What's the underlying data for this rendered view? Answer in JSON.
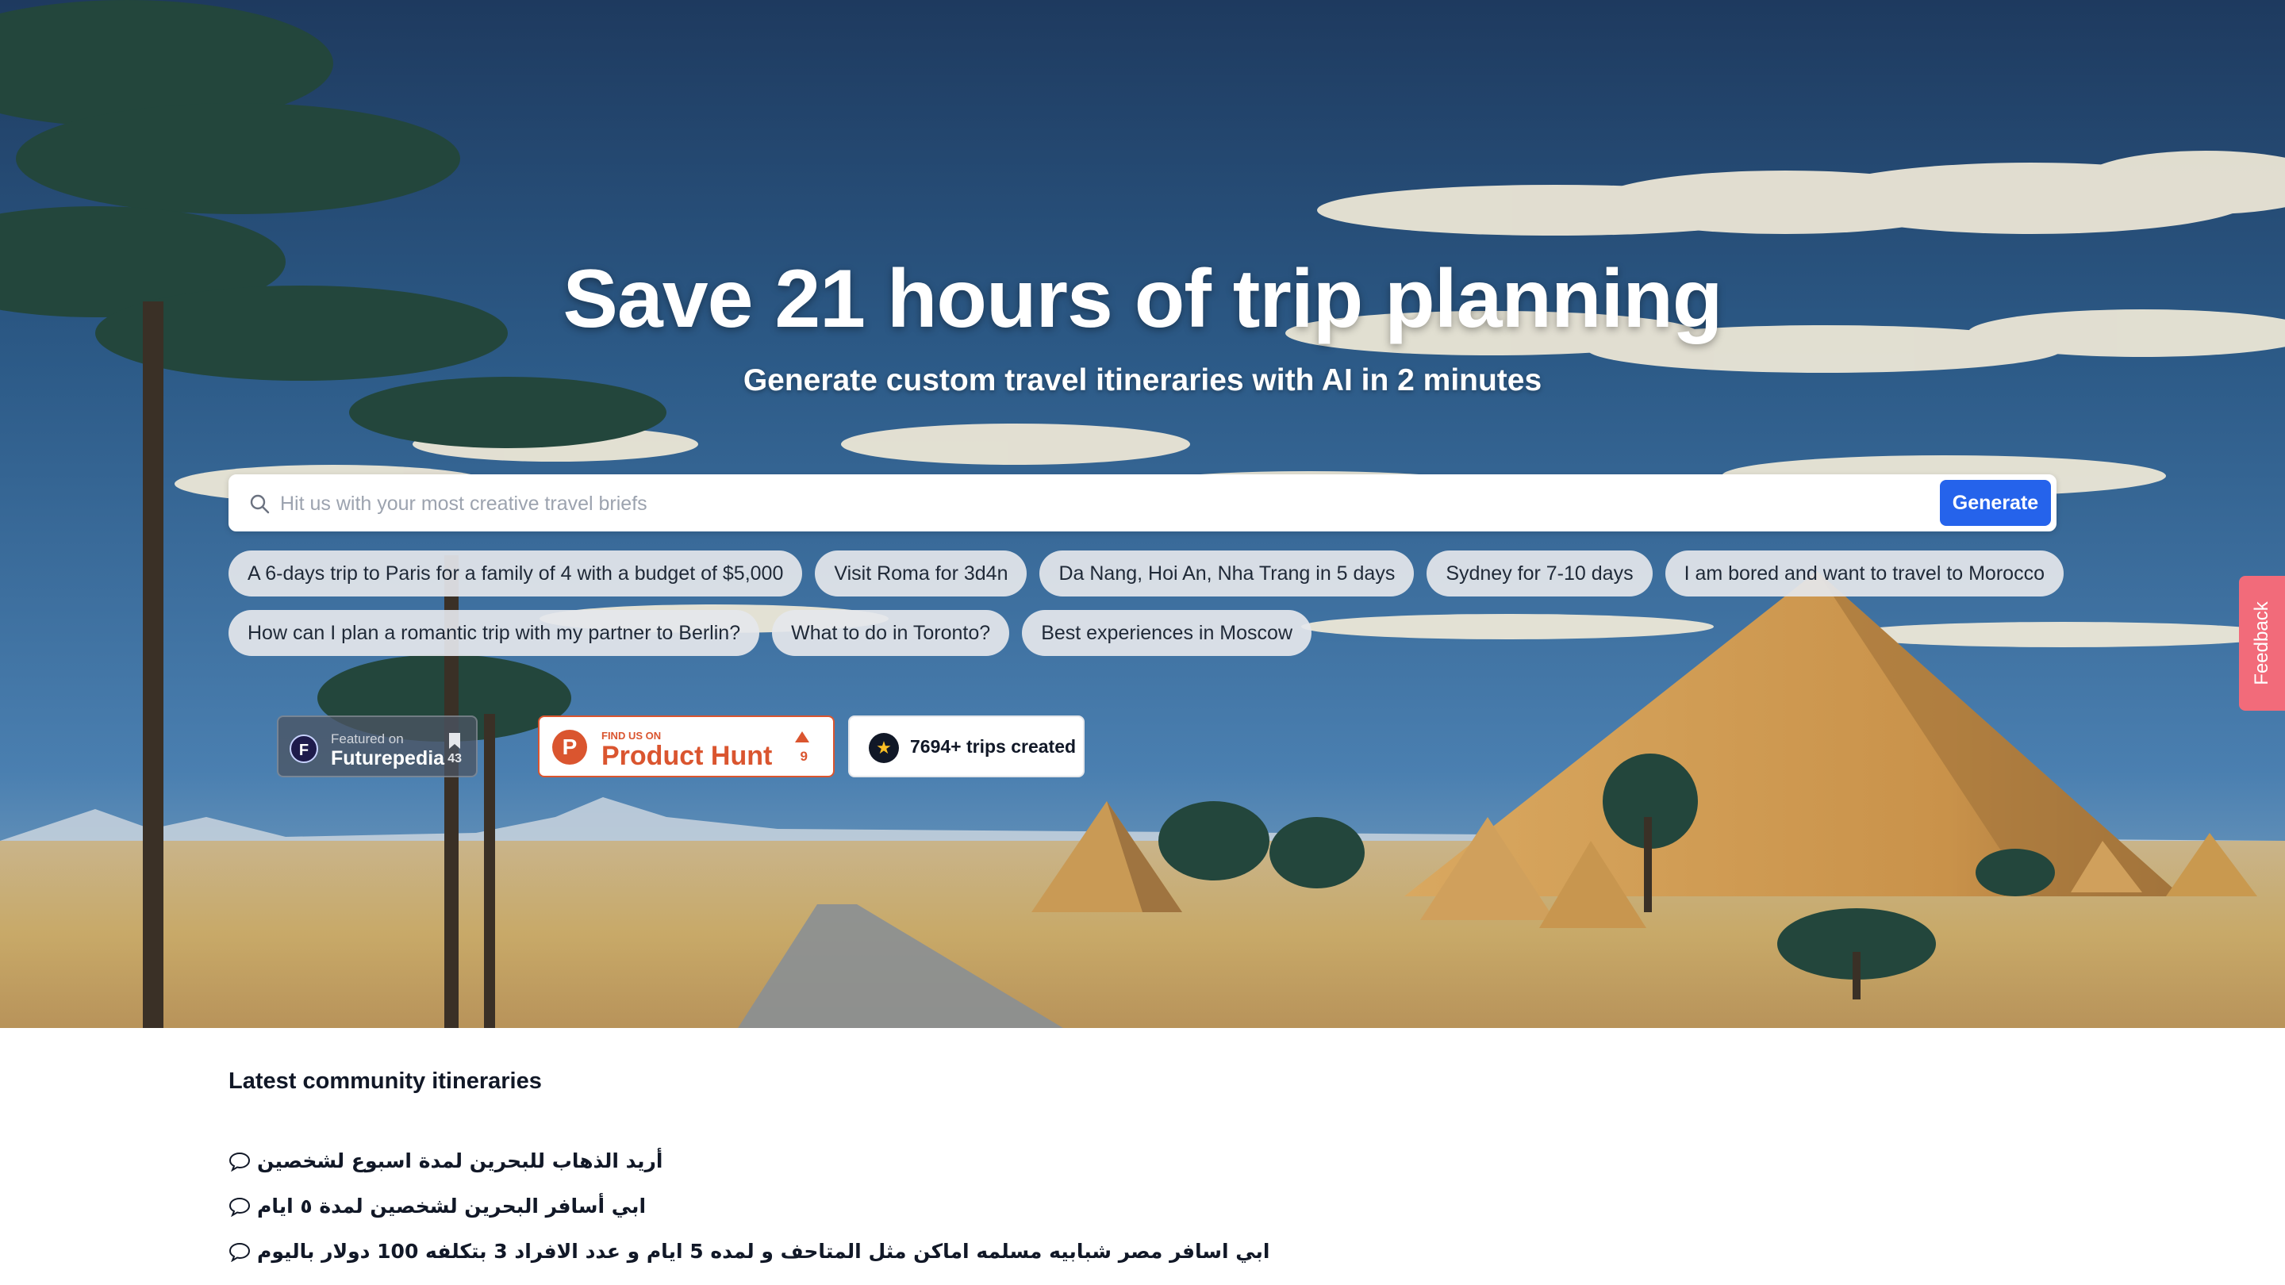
{
  "hero": {
    "title": "Save 21 hours of trip planning",
    "subtitle": "Generate custom travel itineraries with AI in 2 minutes"
  },
  "search": {
    "placeholder": "Hit us with your most creative travel briefs",
    "value": "",
    "icon": "search-icon",
    "button_label": "Generate",
    "button_color": "#2563eb"
  },
  "suggestions": {
    "row1": [
      "A 6-days trip to Paris for a family of 4 with a budget of $5,000",
      "Visit Roma for 3d4n",
      "Da Nang, Hoi An, Nha Trang in 5 days",
      "Sydney for 7-10 days",
      "I am bored and want to travel to Morocco"
    ],
    "row2": [
      "How can I plan a romantic trip with my partner to Berlin?",
      "What to do in Toronto?",
      "Best experiences in Moscow"
    ]
  },
  "badges": {
    "futurepedia": {
      "small": "Featured on",
      "name": "Futurepedia",
      "count": "43"
    },
    "producthunt": {
      "small": "FIND US ON",
      "name": "Product Hunt",
      "count": "9",
      "color": "#da552f"
    },
    "trips": {
      "text": "7694+ trips created"
    }
  },
  "feedback": {
    "label": "Feedback",
    "color": "#f26b7a"
  },
  "community": {
    "title": "Latest community itineraries",
    "items": [
      "أريد الذهاب للبحرين لمدة اسبوع لشخصين",
      "ابي أسافر البحرين لشخصين لمدة ٥ ايام",
      "ابي اسافر مصر شبابيه مسلمه اماكن مثل المتاحف و لمده 5 ايام و عدد الافراد 3 بتكلفه 100 دولار باليوم"
    ]
  }
}
